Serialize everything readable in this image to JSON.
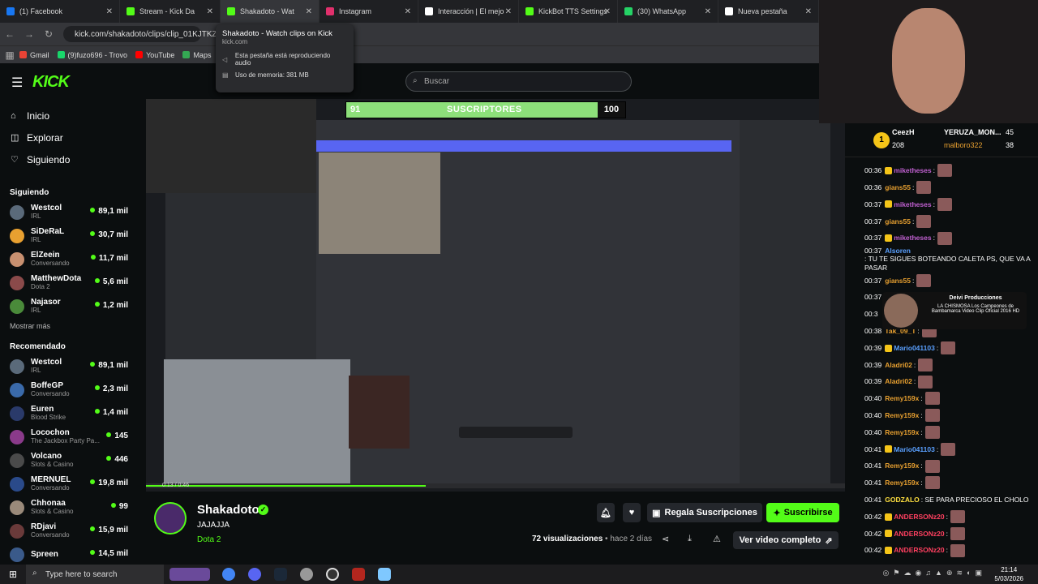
{
  "browser": {
    "tabs": [
      {
        "label": "(1) Facebook",
        "color": "#1877f2"
      },
      {
        "label": "Stream - Kick Da",
        "color": "#53fc18"
      },
      {
        "label": "Shakadoto - Wat",
        "color": "#53fc18"
      },
      {
        "label": "Instagram",
        "color": "#e1306c"
      },
      {
        "label": "Interacción | El mejo",
        "color": "#ffffff"
      },
      {
        "label": "KickBot TTS Settings",
        "color": "#53fc18"
      },
      {
        "label": "(30) WhatsApp",
        "color": "#25d366"
      },
      {
        "label": "Nueva pestaña",
        "color": "#ffffff"
      }
    ],
    "url": "kick.com/shakadoto/clips/clip_01KJTKZ",
    "bookmarks": [
      "Gmail",
      "(9)fuzo696 - Trovo",
      "YouTube",
      "Maps"
    ],
    "tooltip": {
      "title": "Shakadoto - Watch clips on Kick",
      "domain": "kick.com",
      "audio": "Esta pestaña está reproduciendo audio",
      "memory": "Uso de memoria: 381 MB"
    }
  },
  "kick": {
    "logo": "KICK",
    "search_placeholder": "Buscar",
    "nav": [
      {
        "label": "Inicio",
        "icon": "home-icon"
      },
      {
        "label": "Explorar",
        "icon": "compass-icon"
      },
      {
        "label": "Siguiendo",
        "icon": "heart-icon"
      }
    ],
    "following_header": "Siguiendo",
    "following": [
      {
        "name": "Westcol",
        "cat": "IRL",
        "viewers": "89,1 mil",
        "color": "#5a6a7a"
      },
      {
        "name": "SiDeRaL",
        "cat": "IRL",
        "viewers": "30,7 mil",
        "color": "#e8a030"
      },
      {
        "name": "ElZeein",
        "cat": "Conversando",
        "viewers": "11,7 mil",
        "color": "#c89070"
      },
      {
        "name": "MatthewDota",
        "cat": "Dota 2",
        "viewers": "5,6 mil",
        "color": "#8a4a4a"
      },
      {
        "name": "Najasor",
        "cat": "IRL",
        "viewers": "1,2 mil",
        "color": "#4a8a3a"
      }
    ],
    "show_more": "Mostrar más",
    "recommended_header": "Recomendado",
    "recommended": [
      {
        "name": "Westcol",
        "cat": "IRL",
        "viewers": "89,1 mil",
        "color": "#5a6a7a"
      },
      {
        "name": "BoffeGP",
        "cat": "Conversando",
        "viewers": "2,3 mil",
        "color": "#3a6aaa"
      },
      {
        "name": "Euren",
        "cat": "Blood Strike",
        "viewers": "1,4 mil",
        "color": "#2a3a6a"
      },
      {
        "name": "Locochon",
        "cat": "The Jackbox Party Pa...",
        "viewers": "145",
        "color": "#8a3a8a"
      },
      {
        "name": "Volcano",
        "cat": "Slots & Casino",
        "viewers": "446",
        "color": "#4a4a4a"
      },
      {
        "name": "MERNUEL",
        "cat": "Conversando",
        "viewers": "19,8 mil",
        "color": "#2a4a8a"
      },
      {
        "name": "Chhonaa",
        "cat": "Slots & Casino",
        "viewers": "99",
        "color": "#9a8a7a"
      },
      {
        "name": "RDjavi",
        "cat": "Conversando",
        "viewers": "15,9 mil",
        "color": "#6a3a3a"
      },
      {
        "name": "Spreen",
        "cat": "",
        "viewers": "14,5 mil",
        "color": "#3a5a8a"
      }
    ],
    "sub_goal": {
      "current": "91",
      "label": "SUSCRIPTORES",
      "goal": "100",
      "progress": 0.91
    },
    "video_time": "0:13 / 0:46",
    "video_progress": 0.4,
    "clip": {
      "channel": "Shakadoto",
      "title": "JAJAJJA",
      "category": "Dota 2",
      "views_count": "72",
      "views_label": "visualizaciones",
      "age": "hace 2 días"
    },
    "buttons": {
      "gift": "Regala Suscripciones",
      "subscribe": "Suscribirse",
      "full_video": "Ver video completo"
    }
  },
  "chat": {
    "leaderboard": {
      "top_name": "CeezH",
      "top_count": "208",
      "second_name": "YERUZA_MON...",
      "second_count": "45",
      "third_name": "malboro322",
      "third_count": "38",
      "rank": "1"
    },
    "messages": [
      {
        "ts": "00:36",
        "user": "miketheses",
        "color": "#c060d0",
        "text": ":",
        "emote": true,
        "badge": true
      },
      {
        "ts": "00:36",
        "user": "gians55",
        "color": "#e8a030",
        "text": ":",
        "emote": true,
        "badge": false
      },
      {
        "ts": "00:37",
        "user": "miketheses",
        "color": "#c060d0",
        "text": ":",
        "emote": true,
        "badge": true
      },
      {
        "ts": "00:37",
        "user": "gians55",
        "color": "#e8a030",
        "text": ":",
        "emote": true,
        "badge": false
      },
      {
        "ts": "00:37",
        "user": "miketheses",
        "color": "#c060d0",
        "text": ":",
        "emote": true,
        "badge": true
      },
      {
        "ts": "00:37",
        "user": "Alsoren",
        "color": "#5aa0ff",
        "text": ": TU TE SIGUES BOTEANDO CALETA PS, QUE VA A PASAR",
        "emote": false,
        "badge": false
      },
      {
        "ts": "00:37",
        "user": "gians55",
        "color": "#e8a030",
        "text": ":",
        "emote": true,
        "badge": false
      },
      {
        "ts": "00:37",
        "user": "",
        "color": "#ffffff",
        "text": "",
        "emote": false,
        "badge": false
      },
      {
        "ts": "00:3",
        "user": "",
        "color": "#ffffff",
        "text": "",
        "emote": false,
        "badge": false
      },
      {
        "ts": "00:38",
        "user": "Tak_09_T",
        "color": "#e8a030",
        "text": ":",
        "emote": true,
        "badge": false
      },
      {
        "ts": "00:39",
        "user": "Mario041103",
        "color": "#5aa0ff",
        "text": ":",
        "emote": true,
        "badge": true
      },
      {
        "ts": "00:39",
        "user": "Aladri02",
        "color": "#e8a030",
        "text": ":",
        "emote": true,
        "badge": false
      },
      {
        "ts": "00:39",
        "user": "Aladri02",
        "color": "#e8a030",
        "text": ":",
        "emote": true,
        "badge": false
      },
      {
        "ts": "00:40",
        "user": "Remy159x",
        "color": "#e8a030",
        "text": ":",
        "emote": true,
        "badge": false
      },
      {
        "ts": "00:40",
        "user": "Remy159x",
        "color": "#e8a030",
        "text": ":",
        "emote": true,
        "badge": false
      },
      {
        "ts": "00:40",
        "user": "Remy159x",
        "color": "#e8a030",
        "text": ":",
        "emote": true,
        "badge": false
      },
      {
        "ts": "00:41",
        "user": "Mario041103",
        "color": "#5aa0ff",
        "text": ":",
        "emote": true,
        "badge": true
      },
      {
        "ts": "00:41",
        "user": "Remy159x",
        "color": "#e8a030",
        "text": ":",
        "emote": true,
        "badge": false
      },
      {
        "ts": "00:41",
        "user": "Remy159x",
        "color": "#e8a030",
        "text": ":",
        "emote": true,
        "badge": false
      },
      {
        "ts": "00:41",
        "user": "GODZALO",
        "color": "#ffe040",
        "text": ": SE PARA PRECIOSO EL CHOLO",
        "emote": false,
        "badge": false
      },
      {
        "ts": "00:42",
        "user": "ANDERSONz20",
        "color": "#ff4060",
        "text": ":",
        "emote": true,
        "badge": true
      },
      {
        "ts": "00:42",
        "user": "ANDERSONz20",
        "color": "#ff4060",
        "text": ":",
        "emote": true,
        "badge": true
      },
      {
        "ts": "00:42",
        "user": "ANDERSONz20",
        "color": "#ff4060",
        "text": ":",
        "emote": true,
        "badge": true
      }
    ],
    "overlay": {
      "title": "Deivi Producciones",
      "text": "LA CHISMOSA Los Campeones de Bambamarca Video Clip Oficial 2016 HD"
    }
  },
  "taskbar": {
    "search_placeholder": "Type here to search",
    "time": "21:14",
    "date": "5/03/2026"
  }
}
